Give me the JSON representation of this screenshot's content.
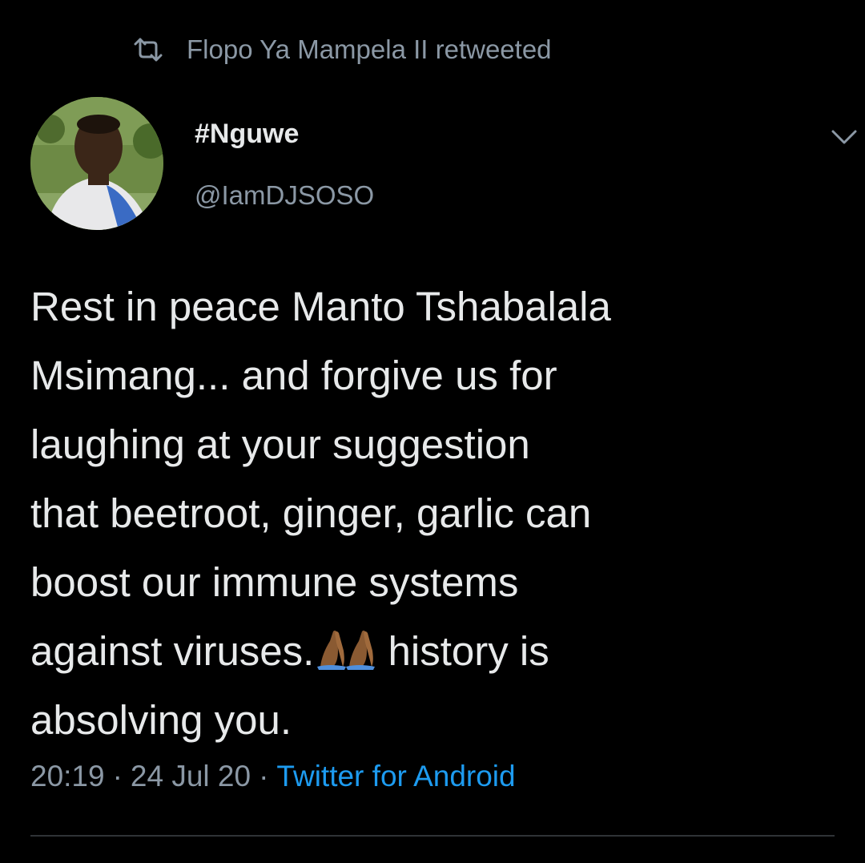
{
  "retweet_banner": {
    "icon": "retweet-icon",
    "text": "Flopo Ya Mampela II retweeted"
  },
  "author": {
    "display_name": "#Nguwe",
    "handle": "@IamDJSOSO",
    "avatar": "profile-photo"
  },
  "menu_icon": "chevron-down-icon",
  "tweet": {
    "lines": [
      "Rest in peace Manto Tshabalala",
      "Msimang... and forgive us for",
      "laughing at your suggestion",
      "that beetroot, ginger, garlic can",
      "boost our immune systems",
      "against viruses.",
      "history is",
      "absolving you."
    ],
    "emoji": "folded-hands-emoji"
  },
  "meta": {
    "time": "20:19",
    "separator": "·",
    "date": "24 Jul 20",
    "source": "Twitter for Android"
  },
  "colors": {
    "background": "#000000",
    "text": "#e7e9ea",
    "muted": "#8b98a5",
    "link": "#1d9bf0"
  }
}
